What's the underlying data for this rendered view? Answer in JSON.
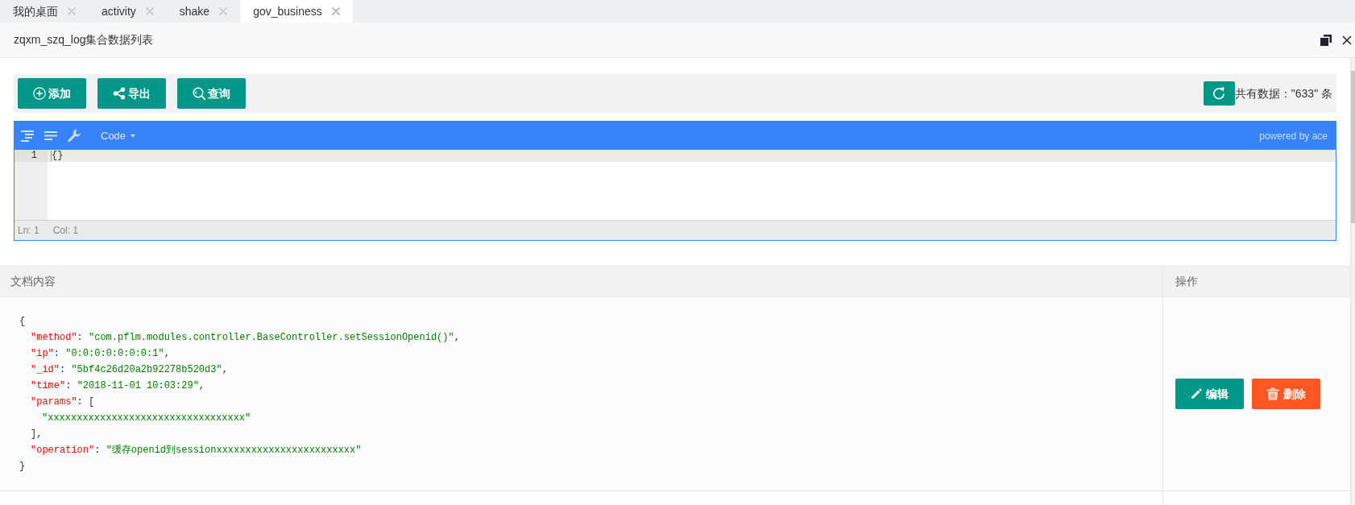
{
  "tabs": [
    {
      "label": "我的桌面",
      "selected": false
    },
    {
      "label": "activity",
      "selected": false
    },
    {
      "label": "shake",
      "selected": false
    },
    {
      "label": "gov_business",
      "selected": true
    }
  ],
  "window": {
    "title": "zqxm_szq_log集合数据列表"
  },
  "toolbar": {
    "buttons": [
      {
        "kind": "add",
        "label": "添加"
      },
      {
        "kind": "export",
        "label": "导出"
      },
      {
        "kind": "search",
        "label": "查询"
      }
    ],
    "record_count": "共有数据：\"633\" 条"
  },
  "editor": {
    "mode": "Code",
    "credit": "powered by ace",
    "lines": [
      {
        "number": "1",
        "text": "{}",
        "active": true
      }
    ],
    "status_bar": [
      "Ln: 1",
      "Col: 1"
    ]
  },
  "table": {
    "columns": [
      "文档内容",
      "操作"
    ],
    "rows": [
      {
        "document": [
          {
            "tokens": [
              {
                "kind": "punct",
                "text": "{"
              }
            ],
            "children": [
              {
                "tokens": [
                  {
                    "kind": "key",
                    "text": "\"method\""
                  },
                  {
                    "kind": "punct",
                    "text": ": "
                  },
                  {
                    "kind": "string",
                    "text": "\"com.pflm.modules.controller.BaseController.setSessionOpenid()\""
                  },
                  {
                    "kind": "punct",
                    "text": ","
                  }
                ]
              },
              {
                "tokens": [
                  {
                    "kind": "key",
                    "text": "\"ip\""
                  },
                  {
                    "kind": "punct",
                    "text": ": "
                  },
                  {
                    "kind": "string",
                    "text": "\"0:0:0:0:0:0:0:1\""
                  },
                  {
                    "kind": "punct",
                    "text": ","
                  }
                ]
              },
              {
                "tokens": [
                  {
                    "kind": "key",
                    "text": "\"_id\""
                  },
                  {
                    "kind": "punct",
                    "text": ": "
                  },
                  {
                    "kind": "string",
                    "text": "\"5bf4c26d20a2b92278b520d3\""
                  },
                  {
                    "kind": "punct",
                    "text": ","
                  }
                ]
              },
              {
                "tokens": [
                  {
                    "kind": "key",
                    "text": "\"time\""
                  },
                  {
                    "kind": "punct",
                    "text": ": "
                  },
                  {
                    "kind": "string",
                    "text": "\"2018-11-01 10:03:29\""
                  },
                  {
                    "kind": "punct",
                    "text": ","
                  }
                ]
              },
              {
                "tokens": [
                  {
                    "kind": "key",
                    "text": "\"params\""
                  },
                  {
                    "kind": "punct",
                    "text": ": ["
                  }
                ],
                "children": [
                  {
                    "tokens": [
                      {
                        "kind": "string",
                        "text": "\"xxxxxxxxxxxxxxxxxxxxxxxxxxxxxxxxxx\""
                      }
                    ]
                  }
                ]
              },
              {
                "tokens": [
                  {
                    "kind": "punct",
                    "text": "],"
                  }
                ]
              },
              {
                "tokens": [
                  {
                    "kind": "key",
                    "text": "\"operation\""
                  },
                  {
                    "kind": "punct",
                    "text": ": "
                  },
                  {
                    "kind": "string",
                    "text": "\"缓存openid到sessionxxxxxxxxxxxxxxxxxxxxxxxx\""
                  }
                ]
              }
            ]
          },
          {
            "tokens": [
              {
                "kind": "punct",
                "text": "}"
              }
            ]
          }
        ],
        "actions": [
          {
            "kind": "edit",
            "label": "编辑"
          },
          {
            "kind": "delete",
            "label": "删除"
          }
        ]
      }
    ]
  }
}
